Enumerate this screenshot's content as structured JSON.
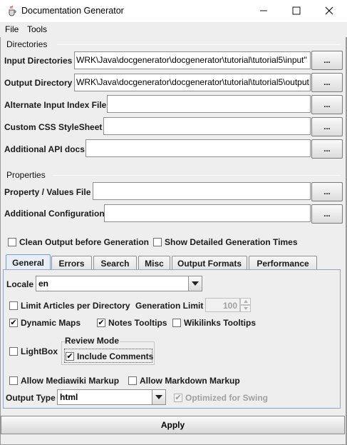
{
  "window": {
    "title": "Documentation Generator"
  },
  "menu": {
    "items": [
      "File",
      "Tools"
    ]
  },
  "directories": {
    "title": "Directories",
    "input_label": "Input Directories",
    "input_value": "WRK\\Java\\docgenerator\\docgenerator\\tutorial\\tutorial5\\input\"",
    "output_label": "Output Directory",
    "output_value": "WRK\\Java\\docgenerator\\docgenerator\\tutorial\\tutorial5\\output",
    "alt_index_label": "Alternate Input Index File",
    "alt_index_value": "",
    "css_label": "Custom CSS StyleSheet",
    "css_value": "",
    "api_label": "Additional API docs",
    "api_value": "",
    "browse_label": "..."
  },
  "properties": {
    "title": "Properties",
    "prop_label": "Property / Values File",
    "prop_value": "",
    "config_label": "Additional Configuration",
    "config_value": ""
  },
  "options": {
    "clean_label": "Clean Output before Generation",
    "clean_checked": false,
    "times_label": "Show Detailed Generation Times",
    "times_checked": false
  },
  "tabs": [
    "General",
    "Errors",
    "Search",
    "Misc",
    "Output Formats",
    "Performance"
  ],
  "general": {
    "locale_label": "Locale",
    "locale_value": "en",
    "limit_label": "Limit Articles per Directory",
    "limit_checked": false,
    "gen_limit_label": "Generation Limit",
    "gen_limit_value": "100",
    "dynamic_maps_label": "Dynamic Maps",
    "dynamic_maps_checked": true,
    "notes_tooltips_label": "Notes Tooltips",
    "notes_tooltips_checked": true,
    "wikilinks_label": "Wikilinks Tooltips",
    "wikilinks_checked": false,
    "lightbox_label": "LightBox",
    "lightbox_checked": false,
    "review_mode_title": "Review Mode",
    "include_comments_label": "Include Comments",
    "include_comments_checked": true,
    "mediawiki_label": "Allow Mediawiki Markup",
    "mediawiki_checked": false,
    "markdown_label": "Allow Markdown Markup",
    "markdown_checked": false,
    "output_type_label": "Output Type",
    "output_type_value": "html",
    "optimized_label": "Optimized for Swing",
    "optimized_checked": true
  },
  "apply_label": "Apply",
  "check_mark": "✔"
}
